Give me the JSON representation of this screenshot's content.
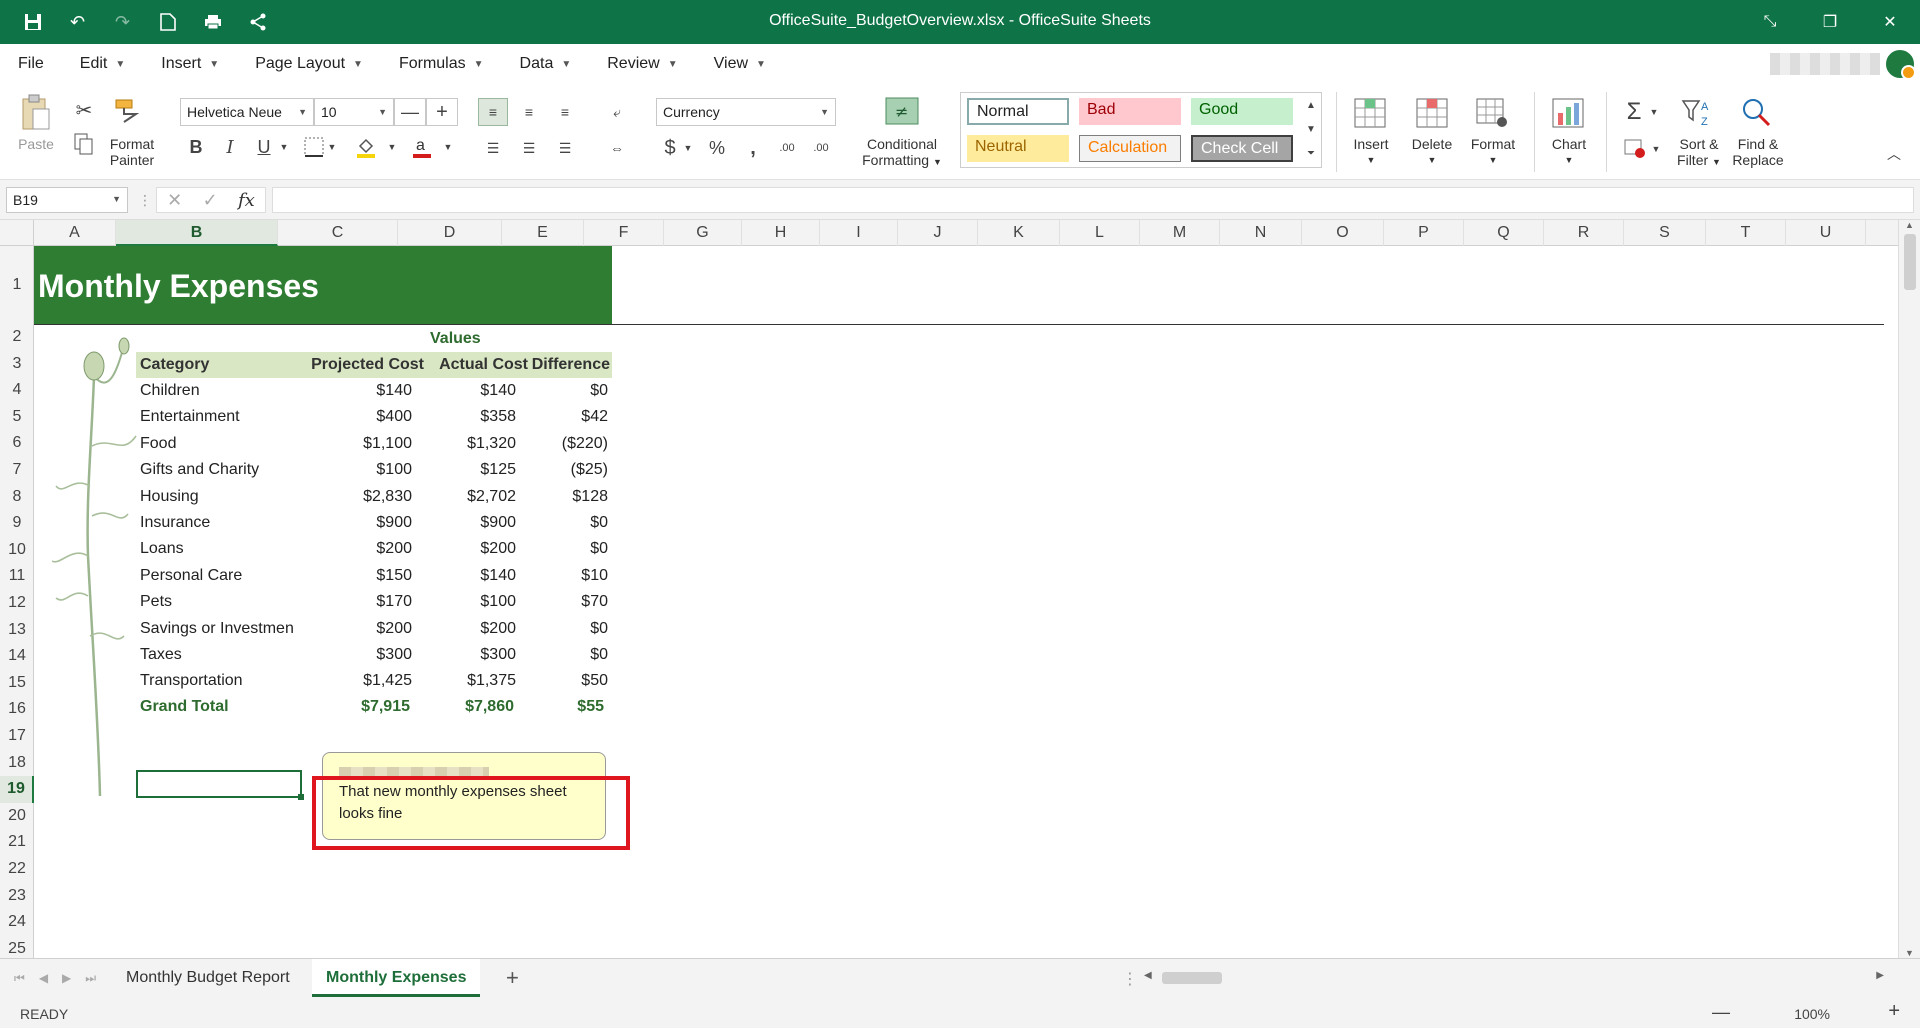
{
  "window": {
    "title": "OfficeSuite_BudgetOverview.xlsx - OfficeSuite Sheets"
  },
  "menu": [
    "File",
    "Edit",
    "Insert",
    "Page Layout",
    "Formulas",
    "Data",
    "Review",
    "View"
  ],
  "ribbon": {
    "paste": "Paste",
    "format_painter_1": "Format",
    "format_painter_2": "Painter",
    "font_name": "Helvetica Neue",
    "font_size": "10",
    "number_format": "Currency",
    "cond_format_1": "Conditional",
    "cond_format_2": "Formatting",
    "styles": {
      "normal": "Normal",
      "bad": "Bad",
      "good": "Good",
      "neutral": "Neutral",
      "calculation": "Calculation",
      "check_cell": "Check Cell"
    },
    "insert": "Insert",
    "delete": "Delete",
    "format": "Format",
    "chart": "Chart",
    "sort_1": "Sort &",
    "sort_2": "Filter",
    "find_1": "Find &",
    "find_2": "Replace"
  },
  "formula_bar": {
    "name_box": "B19",
    "fx": "fx",
    "value": ""
  },
  "columns": [
    "A",
    "B",
    "C",
    "D",
    "E",
    "F",
    "G",
    "H",
    "I",
    "J",
    "K",
    "L",
    "M",
    "N",
    "O",
    "P",
    "Q",
    "R",
    "S",
    "T",
    "U"
  ],
  "rows": [
    "1",
    "2",
    "3",
    "4",
    "5",
    "6",
    "7",
    "8",
    "9",
    "10",
    "11",
    "12",
    "13",
    "14",
    "15",
    "16",
    "17",
    "18",
    "19",
    "20",
    "21",
    "22",
    "23",
    "24",
    "25"
  ],
  "sheet": {
    "title": "Monthly Expenses",
    "values_label": "Values",
    "headers": [
      "Category",
      "Projected Cost",
      "Actual Cost",
      "Difference"
    ],
    "data": [
      [
        "Children",
        "$140",
        "$140",
        "$0"
      ],
      [
        "Entertainment",
        "$400",
        "$358",
        "$42"
      ],
      [
        "Food",
        "$1,100",
        "$1,320",
        "($220)"
      ],
      [
        "Gifts and Charity",
        "$100",
        "$125",
        "($25)"
      ],
      [
        "Housing",
        "$2,830",
        "$2,702",
        "$128"
      ],
      [
        "Insurance",
        "$900",
        "$900",
        "$0"
      ],
      [
        "Loans",
        "$200",
        "$200",
        "$0"
      ],
      [
        "Personal Care",
        "$150",
        "$140",
        "$10"
      ],
      [
        "Pets",
        "$170",
        "$100",
        "$70"
      ],
      [
        "Savings or Investmen",
        "$200",
        "$200",
        "$0"
      ],
      [
        "Taxes",
        "$300",
        "$300",
        "$0"
      ],
      [
        "Transportation",
        "$1,425",
        "$1,375",
        "$50"
      ]
    ],
    "total": [
      "Grand Total",
      "$7,915",
      "$7,860",
      "$55"
    ]
  },
  "comment": {
    "text": "That new monthly expenses sheet looks fine"
  },
  "tabs": [
    "Monthly Budget Report",
    "Monthly Expenses"
  ],
  "status": {
    "ready": "READY",
    "zoom": "100%"
  }
}
